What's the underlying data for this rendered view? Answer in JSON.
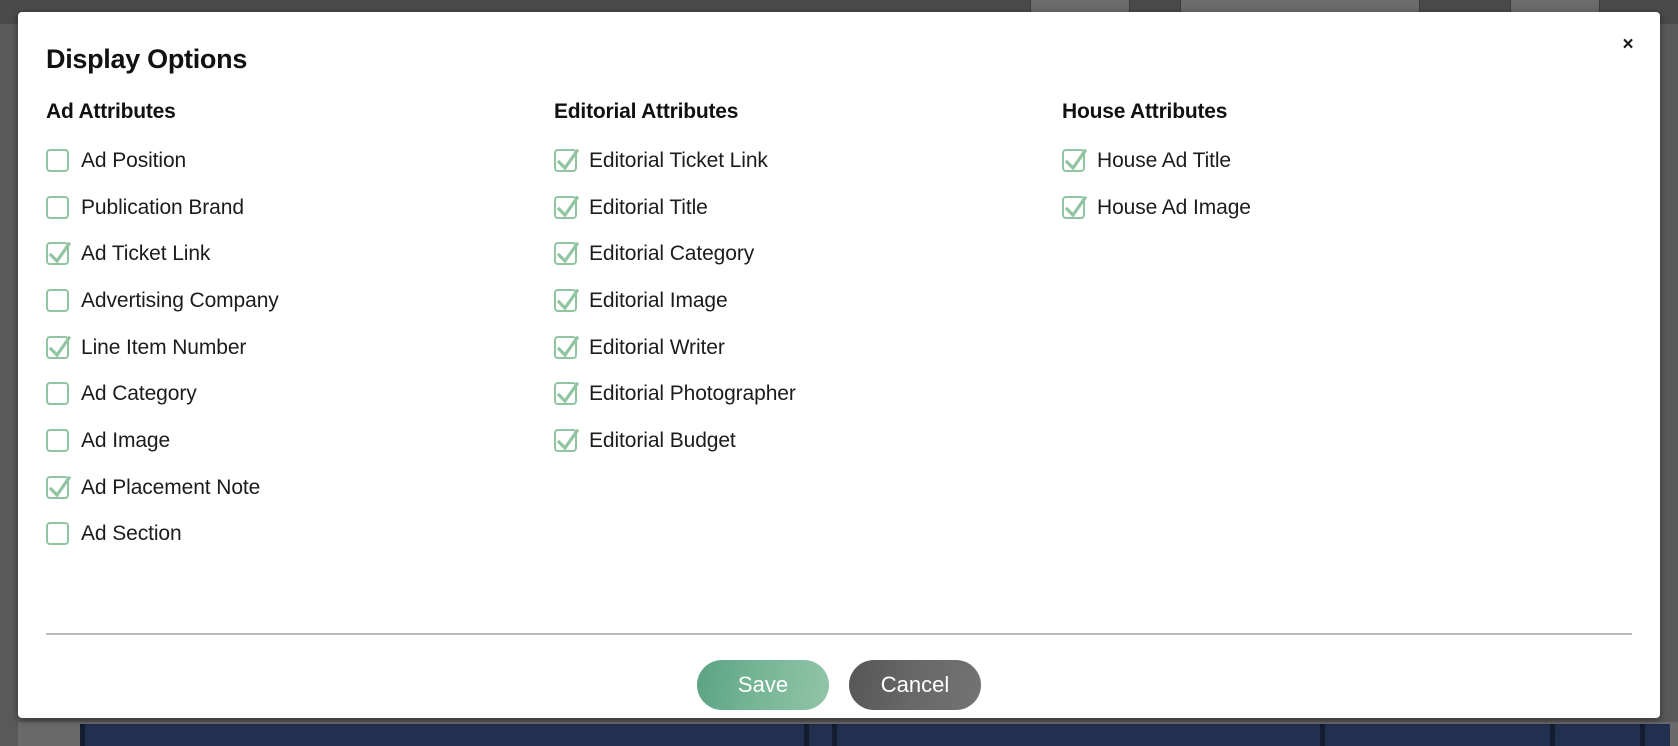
{
  "modal": {
    "title": "Display Options",
    "close_label": "×",
    "close_icon": "close-icon"
  },
  "columns": [
    {
      "heading": "Ad Attributes",
      "key": "ad-attributes",
      "items": [
        {
          "label": "Ad Position",
          "checked": false
        },
        {
          "label": "Publication Brand",
          "checked": false
        },
        {
          "label": "Ad Ticket Link",
          "checked": true
        },
        {
          "label": "Advertising Company",
          "checked": false
        },
        {
          "label": "Line Item Number",
          "checked": true
        },
        {
          "label": "Ad Category",
          "checked": false
        },
        {
          "label": "Ad Image",
          "checked": false
        },
        {
          "label": "Ad Placement Note",
          "checked": true
        },
        {
          "label": "Ad Section",
          "checked": false
        }
      ]
    },
    {
      "heading": "Editorial Attributes",
      "key": "editorial-attributes",
      "items": [
        {
          "label": "Editorial Ticket Link",
          "checked": true
        },
        {
          "label": "Editorial Title",
          "checked": true
        },
        {
          "label": "Editorial Category",
          "checked": true
        },
        {
          "label": "Editorial Image",
          "checked": true
        },
        {
          "label": "Editorial Writer",
          "checked": true
        },
        {
          "label": "Editorial Photographer",
          "checked": true
        },
        {
          "label": "Editorial Budget",
          "checked": true
        }
      ]
    },
    {
      "heading": "House Attributes",
      "key": "house-attributes",
      "items": [
        {
          "label": "House Ad Title",
          "checked": true
        },
        {
          "label": "House Ad Image",
          "checked": true
        }
      ]
    }
  ],
  "footer": {
    "save_label": "Save",
    "cancel_label": "Cancel"
  },
  "colors": {
    "checkbox_green": "#91c5a1",
    "save_button_green": "#75b596",
    "cancel_button_gray": "#686868",
    "backdrop_gray": "#595959",
    "backdrop_navy": "#22304f",
    "divider_gray": "#b9b9b9",
    "text_dark": "#1c1c1c"
  }
}
